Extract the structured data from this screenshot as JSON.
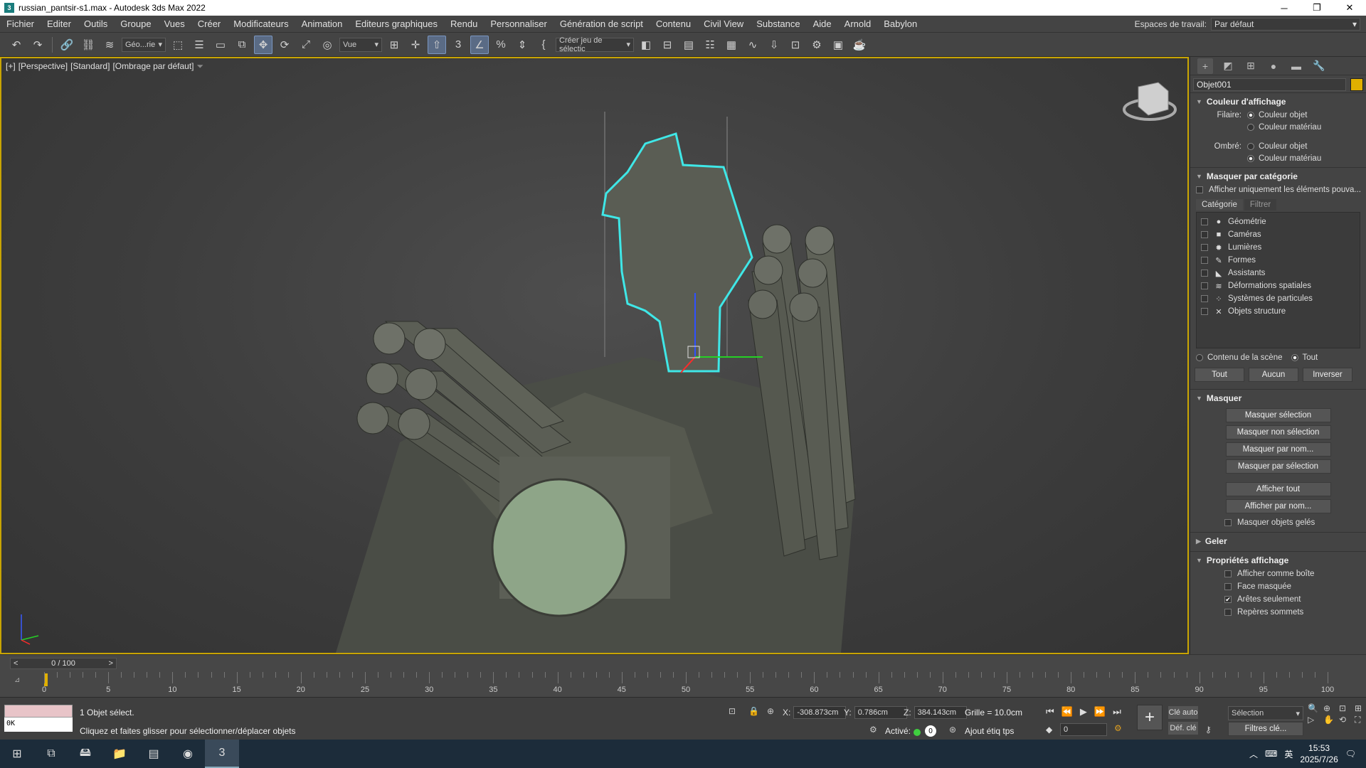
{
  "window": {
    "title": "russian_pantsir-s1.max - Autodesk 3ds Max 2022",
    "minimize": "─",
    "maximize": "❐",
    "close": "✕"
  },
  "menu": [
    "Fichier",
    "Editer",
    "Outils",
    "Groupe",
    "Vues",
    "Créer",
    "Modificateurs",
    "Animation",
    "Editeurs graphiques",
    "Rendu",
    "Personnaliser",
    "Génération de script",
    "Contenu",
    "Civil View",
    "Substance",
    "Aide",
    "Arnold",
    "Babylon"
  ],
  "workspace": {
    "label": "Espaces de travail:",
    "value": "Par défaut"
  },
  "toolbar": {
    "selection_filter": "Géo...rie",
    "ref_coord": "Vue",
    "named_sel": "Créer jeu de sélectic"
  },
  "viewport": {
    "label_plus": "[+]",
    "label_view": "[Perspective]",
    "label_mode": "[Standard]",
    "label_shading": "[Ombrage par défaut]"
  },
  "command_panel": {
    "object_name": "Objet001",
    "object_color": "#e0b000",
    "display_color": {
      "title": "Couleur d'affichage",
      "wire_label": "Filaire:",
      "shaded_label": "Ombré:",
      "opt_object": "Couleur objet",
      "opt_material": "Couleur matériau",
      "wire_selected": "object",
      "shaded_selected": "material"
    },
    "hide_by_category": {
      "title": "Masquer par catégorie",
      "only_show": "Afficher uniquement les éléments pouva...",
      "tab_category": "Catégorie",
      "tab_filter": "Filtrer",
      "categories": [
        {
          "icon": "●",
          "label": "Géométrie"
        },
        {
          "icon": "■",
          "label": "Caméras"
        },
        {
          "icon": "✹",
          "label": "Lumières"
        },
        {
          "icon": "✎",
          "label": "Formes"
        },
        {
          "icon": "◣",
          "label": "Assistants"
        },
        {
          "icon": "≋",
          "label": "Déformations spatiales"
        },
        {
          "icon": "⁘",
          "label": "Systèmes de particules"
        },
        {
          "icon": "✕",
          "label": "Objets structure"
        }
      ],
      "scene_content": "Contenu de la scène",
      "all_radio": "Tout",
      "btn_all": "Tout",
      "btn_none": "Aucun",
      "btn_invert": "Inverser"
    },
    "hide": {
      "title": "Masquer",
      "buttons": [
        "Masquer sélection",
        "Masquer non sélection",
        "Masquer par nom...",
        "Masquer par sélection"
      ],
      "buttons2": [
        "Afficher tout",
        "Afficher par nom..."
      ],
      "hide_frozen": "Masquer objets gelés"
    },
    "freeze": {
      "title": "Geler"
    },
    "display_props": {
      "title": "Propriétés affichage",
      "items": [
        {
          "label": "Afficher comme boîte",
          "checked": false
        },
        {
          "label": "Face masquée",
          "checked": false
        },
        {
          "label": "Arêtes seulement",
          "checked": true
        },
        {
          "label": "Repères sommets",
          "checked": false
        }
      ]
    }
  },
  "timeline": {
    "frame": "0 / 100",
    "prev": "<",
    "next": ">",
    "ticks": [
      "0",
      "5",
      "10",
      "15",
      "20",
      "25",
      "30",
      "35",
      "40",
      "45",
      "50",
      "55",
      "60",
      "65",
      "70",
      "75",
      "80",
      "85",
      "90",
      "95",
      "100"
    ]
  },
  "status": {
    "ok": "0K",
    "selected": "1 Objet sélect.",
    "prompt": "Cliquez et faites glisser pour sélectionner/déplacer objets",
    "x_label": "X:",
    "x": "-308.873cm",
    "y_label": "Y:",
    "y": "0.786cm",
    "z_label": "Z:",
    "z": "384.143cm",
    "grid": "Grille = 10.0cm",
    "enabled": "Activé:",
    "enabled_count": "0",
    "add_tag": "Ajout étiq tps",
    "auto_key": "Clé auto",
    "set_key": "Déf. clé",
    "sel_dropdown": "Sélection",
    "key_filters": "Filtres clé...",
    "frame_field": "0"
  },
  "taskbar": {
    "time": "15:53",
    "date": "2025/7/26",
    "ime": "英"
  }
}
